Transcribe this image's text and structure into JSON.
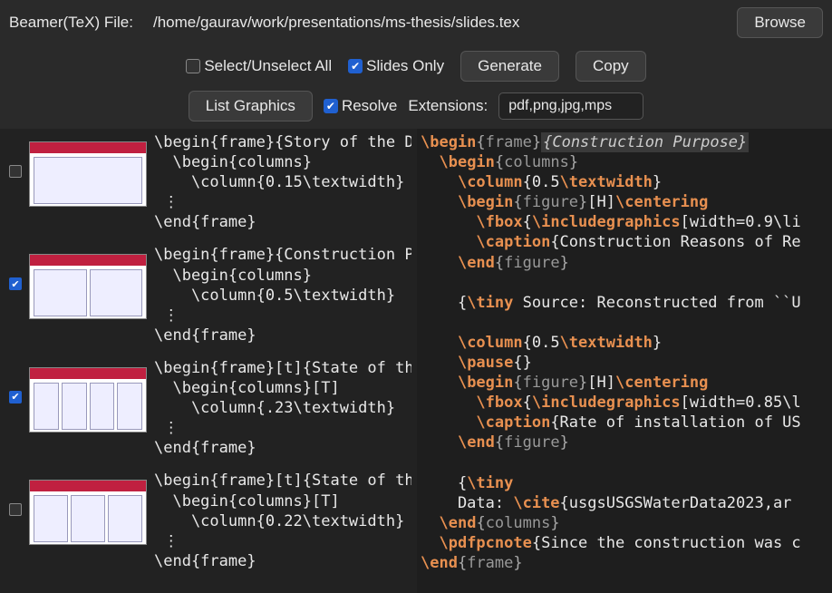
{
  "topbar": {
    "file_label": "Beamer(TeX) File:",
    "filepath": "/home/gaurav/work/presentations/ms-thesis/slides.tex",
    "browse": "Browse"
  },
  "toolbar": {
    "select_all": {
      "label": "Select/Unselect All",
      "checked": false
    },
    "slides_only": {
      "label": "Slides Only",
      "checked": true
    },
    "generate": "Generate",
    "copy": "Copy"
  },
  "toolbar2": {
    "list_graphics": "List Graphics",
    "resolve": {
      "label": "Resolve",
      "checked": true
    },
    "extensions_label": "Extensions:",
    "extensions_value": "pdf,png,jpg,mps"
  },
  "slides": [
    {
      "checked": false,
      "lines": [
        "\\begin{frame}{Story of the Da",
        "  \\begin{columns}",
        "    \\column{0.15\\textwidth}",
        " ⋮",
        "\\end{frame}"
      ]
    },
    {
      "checked": true,
      "lines": [
        "\\begin{frame}{Construction P",
        "  \\begin{columns}",
        "    \\column{0.5\\textwidth}",
        " ⋮",
        "\\end{frame}"
      ]
    },
    {
      "checked": true,
      "lines": [
        "\\begin{frame}[t]{State of the ",
        "  \\begin{columns}[T]",
        "    \\column{.23\\textwidth}",
        " ⋮",
        "\\end{frame}"
      ]
    },
    {
      "checked": false,
      "lines": [
        "\\begin{frame}[t]{State of the ",
        "  \\begin{columns}[T]",
        "    \\column{0.22\\textwidth}",
        " ⋮",
        "\\end{frame}"
      ]
    }
  ],
  "code": {
    "title": "Construction Purpose",
    "lines_raw": [
      "\\begin{frame}{Construction Purpose}",
      "  \\begin{columns}",
      "    \\column{0.5\\textwidth}",
      "    \\begin{figure}[H]\\centering",
      "      \\fbox{\\includegraphics[width=0.9\\li",
      "      \\caption{Construction Reasons of Re",
      "    \\end{figure}",
      "",
      "    {\\tiny Source: Reconstructed from ``U",
      "",
      "    \\column{0.5\\textwidth}",
      "    \\pause{}",
      "    \\begin{figure}[H]\\centering",
      "      \\fbox{\\includegraphics[width=0.85\\l",
      "      \\caption{Rate of installation of US",
      "    \\end{figure}",
      "",
      "    {\\tiny",
      "    Data: \\cite{usgsUSGSWaterData2023,ar",
      "  \\end{columns}",
      "  \\pdfpcnote{Since the construction was c",
      "\\end{frame}"
    ]
  }
}
